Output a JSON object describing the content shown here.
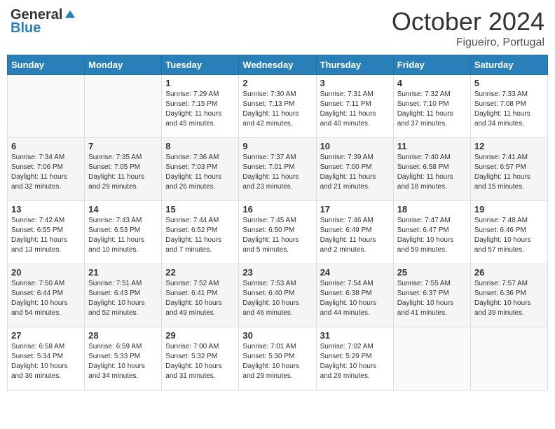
{
  "header": {
    "logo": {
      "general": "General",
      "blue": "Blue"
    },
    "title": "October 2024",
    "subtitle": "Figueiro, Portugal"
  },
  "weekdays": [
    "Sunday",
    "Monday",
    "Tuesday",
    "Wednesday",
    "Thursday",
    "Friday",
    "Saturday"
  ],
  "weeks": [
    [
      {
        "day": null
      },
      {
        "day": null
      },
      {
        "day": 1,
        "sunrise": "Sunrise: 7:29 AM",
        "sunset": "Sunset: 7:15 PM",
        "daylight": "Daylight: 11 hours and 45 minutes."
      },
      {
        "day": 2,
        "sunrise": "Sunrise: 7:30 AM",
        "sunset": "Sunset: 7:13 PM",
        "daylight": "Daylight: 11 hours and 42 minutes."
      },
      {
        "day": 3,
        "sunrise": "Sunrise: 7:31 AM",
        "sunset": "Sunset: 7:11 PM",
        "daylight": "Daylight: 11 hours and 40 minutes."
      },
      {
        "day": 4,
        "sunrise": "Sunrise: 7:32 AM",
        "sunset": "Sunset: 7:10 PM",
        "daylight": "Daylight: 11 hours and 37 minutes."
      },
      {
        "day": 5,
        "sunrise": "Sunrise: 7:33 AM",
        "sunset": "Sunset: 7:08 PM",
        "daylight": "Daylight: 11 hours and 34 minutes."
      }
    ],
    [
      {
        "day": 6,
        "sunrise": "Sunrise: 7:34 AM",
        "sunset": "Sunset: 7:06 PM",
        "daylight": "Daylight: 11 hours and 32 minutes."
      },
      {
        "day": 7,
        "sunrise": "Sunrise: 7:35 AM",
        "sunset": "Sunset: 7:05 PM",
        "daylight": "Daylight: 11 hours and 29 minutes."
      },
      {
        "day": 8,
        "sunrise": "Sunrise: 7:36 AM",
        "sunset": "Sunset: 7:03 PM",
        "daylight": "Daylight: 11 hours and 26 minutes."
      },
      {
        "day": 9,
        "sunrise": "Sunrise: 7:37 AM",
        "sunset": "Sunset: 7:01 PM",
        "daylight": "Daylight: 11 hours and 23 minutes."
      },
      {
        "day": 10,
        "sunrise": "Sunrise: 7:39 AM",
        "sunset": "Sunset: 7:00 PM",
        "daylight": "Daylight: 11 hours and 21 minutes."
      },
      {
        "day": 11,
        "sunrise": "Sunrise: 7:40 AM",
        "sunset": "Sunset: 6:58 PM",
        "daylight": "Daylight: 11 hours and 18 minutes."
      },
      {
        "day": 12,
        "sunrise": "Sunrise: 7:41 AM",
        "sunset": "Sunset: 6:57 PM",
        "daylight": "Daylight: 11 hours and 15 minutes."
      }
    ],
    [
      {
        "day": 13,
        "sunrise": "Sunrise: 7:42 AM",
        "sunset": "Sunset: 6:55 PM",
        "daylight": "Daylight: 11 hours and 13 minutes."
      },
      {
        "day": 14,
        "sunrise": "Sunrise: 7:43 AM",
        "sunset": "Sunset: 6:53 PM",
        "daylight": "Daylight: 11 hours and 10 minutes."
      },
      {
        "day": 15,
        "sunrise": "Sunrise: 7:44 AM",
        "sunset": "Sunset: 6:52 PM",
        "daylight": "Daylight: 11 hours and 7 minutes."
      },
      {
        "day": 16,
        "sunrise": "Sunrise: 7:45 AM",
        "sunset": "Sunset: 6:50 PM",
        "daylight": "Daylight: 11 hours and 5 minutes."
      },
      {
        "day": 17,
        "sunrise": "Sunrise: 7:46 AM",
        "sunset": "Sunset: 6:49 PM",
        "daylight": "Daylight: 11 hours and 2 minutes."
      },
      {
        "day": 18,
        "sunrise": "Sunrise: 7:47 AM",
        "sunset": "Sunset: 6:47 PM",
        "daylight": "Daylight: 10 hours and 59 minutes."
      },
      {
        "day": 19,
        "sunrise": "Sunrise: 7:48 AM",
        "sunset": "Sunset: 6:46 PM",
        "daylight": "Daylight: 10 hours and 57 minutes."
      }
    ],
    [
      {
        "day": 20,
        "sunrise": "Sunrise: 7:50 AM",
        "sunset": "Sunset: 6:44 PM",
        "daylight": "Daylight: 10 hours and 54 minutes."
      },
      {
        "day": 21,
        "sunrise": "Sunrise: 7:51 AM",
        "sunset": "Sunset: 6:43 PM",
        "daylight": "Daylight: 10 hours and 52 minutes."
      },
      {
        "day": 22,
        "sunrise": "Sunrise: 7:52 AM",
        "sunset": "Sunset: 6:41 PM",
        "daylight": "Daylight: 10 hours and 49 minutes."
      },
      {
        "day": 23,
        "sunrise": "Sunrise: 7:53 AM",
        "sunset": "Sunset: 6:40 PM",
        "daylight": "Daylight: 10 hours and 46 minutes."
      },
      {
        "day": 24,
        "sunrise": "Sunrise: 7:54 AM",
        "sunset": "Sunset: 6:38 PM",
        "daylight": "Daylight: 10 hours and 44 minutes."
      },
      {
        "day": 25,
        "sunrise": "Sunrise: 7:55 AM",
        "sunset": "Sunset: 6:37 PM",
        "daylight": "Daylight: 10 hours and 41 minutes."
      },
      {
        "day": 26,
        "sunrise": "Sunrise: 7:57 AM",
        "sunset": "Sunset: 6:36 PM",
        "daylight": "Daylight: 10 hours and 39 minutes."
      }
    ],
    [
      {
        "day": 27,
        "sunrise": "Sunrise: 6:58 AM",
        "sunset": "Sunset: 5:34 PM",
        "daylight": "Daylight: 10 hours and 36 minutes."
      },
      {
        "day": 28,
        "sunrise": "Sunrise: 6:59 AM",
        "sunset": "Sunset: 5:33 PM",
        "daylight": "Daylight: 10 hours and 34 minutes."
      },
      {
        "day": 29,
        "sunrise": "Sunrise: 7:00 AM",
        "sunset": "Sunset: 5:32 PM",
        "daylight": "Daylight: 10 hours and 31 minutes."
      },
      {
        "day": 30,
        "sunrise": "Sunrise: 7:01 AM",
        "sunset": "Sunset: 5:30 PM",
        "daylight": "Daylight: 10 hours and 29 minutes."
      },
      {
        "day": 31,
        "sunrise": "Sunrise: 7:02 AM",
        "sunset": "Sunset: 5:29 PM",
        "daylight": "Daylight: 10 hours and 26 minutes."
      },
      {
        "day": null
      },
      {
        "day": null
      }
    ]
  ]
}
